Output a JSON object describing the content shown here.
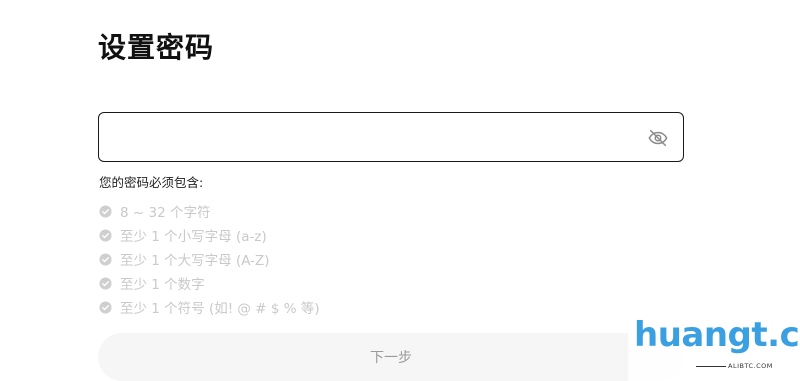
{
  "page": {
    "title": "设置密码"
  },
  "password": {
    "value": "",
    "placeholder": "",
    "toggle_icon": "eye-off-icon"
  },
  "rules": {
    "heading": "您的密码必须包含:",
    "items": [
      {
        "label": "8 ~ 32 个字符"
      },
      {
        "label": "至少 1 个小写字母 (a-z)"
      },
      {
        "label": "至少 1 个大写字母 (A-Z)"
      },
      {
        "label": "至少 1 个数字"
      },
      {
        "label": "至少 1 个符号 (如! @ # $ % 等)"
      }
    ],
    "check_icon": "check-circle-icon"
  },
  "actions": {
    "next_label": "下一步"
  },
  "watermark": {
    "text": "huangt.cn",
    "subtext": "ALIBTC.COM"
  },
  "colors": {
    "title": "#111111",
    "field_border": "#1a1a1a",
    "rule_inactive": "#c9c9c9",
    "button_bg": "#f6f6f6",
    "button_text": "#9a9a9a",
    "watermark_blue": "#3aa0e2"
  }
}
